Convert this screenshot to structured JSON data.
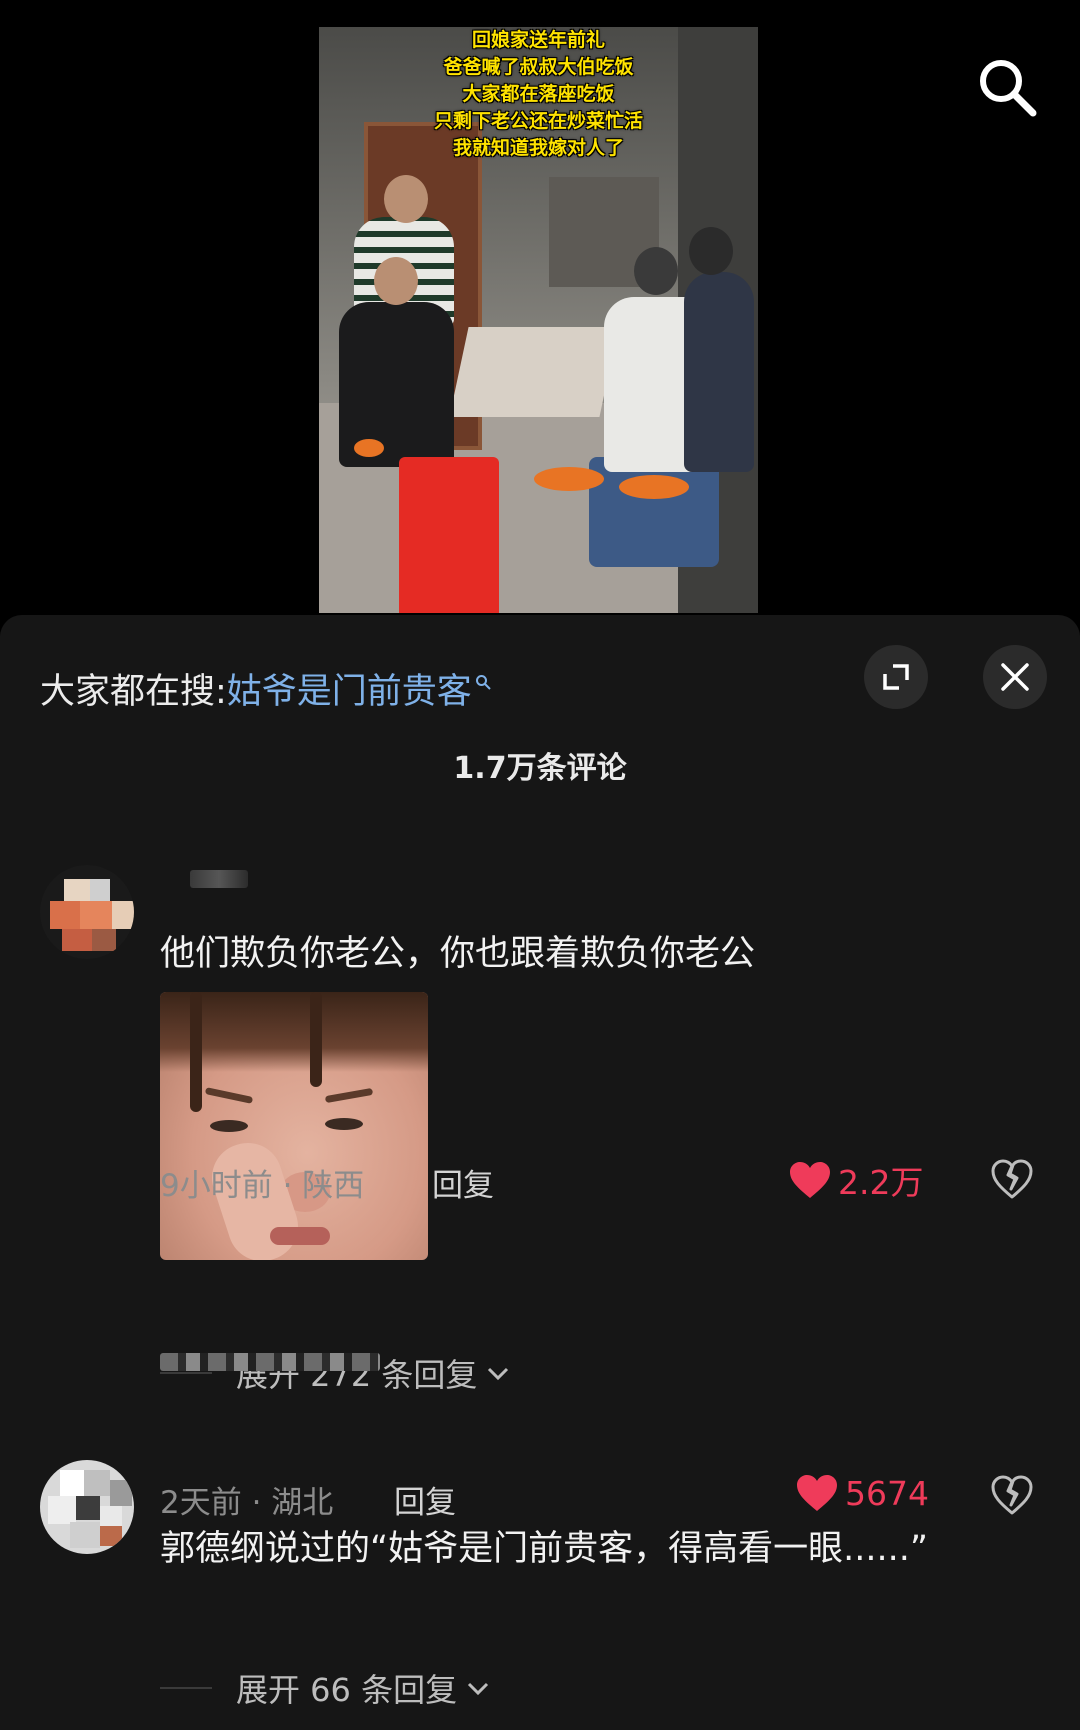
{
  "video": {
    "caption_lines": [
      "回娘家送年前礼",
      "爸爸喊了叔叔大伯吃饭",
      "大家都在落座吃饭",
      "只剩下老公还在炒菜忙活",
      "我就知道我嫁对人了"
    ],
    "search_icon": "search-icon"
  },
  "comments_panel": {
    "search_hint_prefix": "大家都在搜:",
    "search_hint_keyword": "姑爷是门前贵客",
    "comment_count": "1.7万条评论",
    "expand_icon": "expand-icon",
    "close_icon": "close-icon"
  },
  "comments": [
    {
      "text": "他们欺负你老公，你也跟着欺负你老公",
      "time_location": "9小时前 · 陕西",
      "reply_label": "回复",
      "likes": "2.2万",
      "expand_replies": "展开 272 条回复"
    },
    {
      "text": "郭德纲说过的“姑爷是门前贵客，得高看一眼......”",
      "time_location": "2天前 · 湖北",
      "reply_label": "回复",
      "likes": "5674",
      "expand_replies": "展开 66 条回复"
    }
  ],
  "colors": {
    "caption_yellow": "#ffe300",
    "keyword_blue": "#7fb1e8",
    "like_red": "#ef3b5a",
    "sheet_bg": "#161616"
  }
}
